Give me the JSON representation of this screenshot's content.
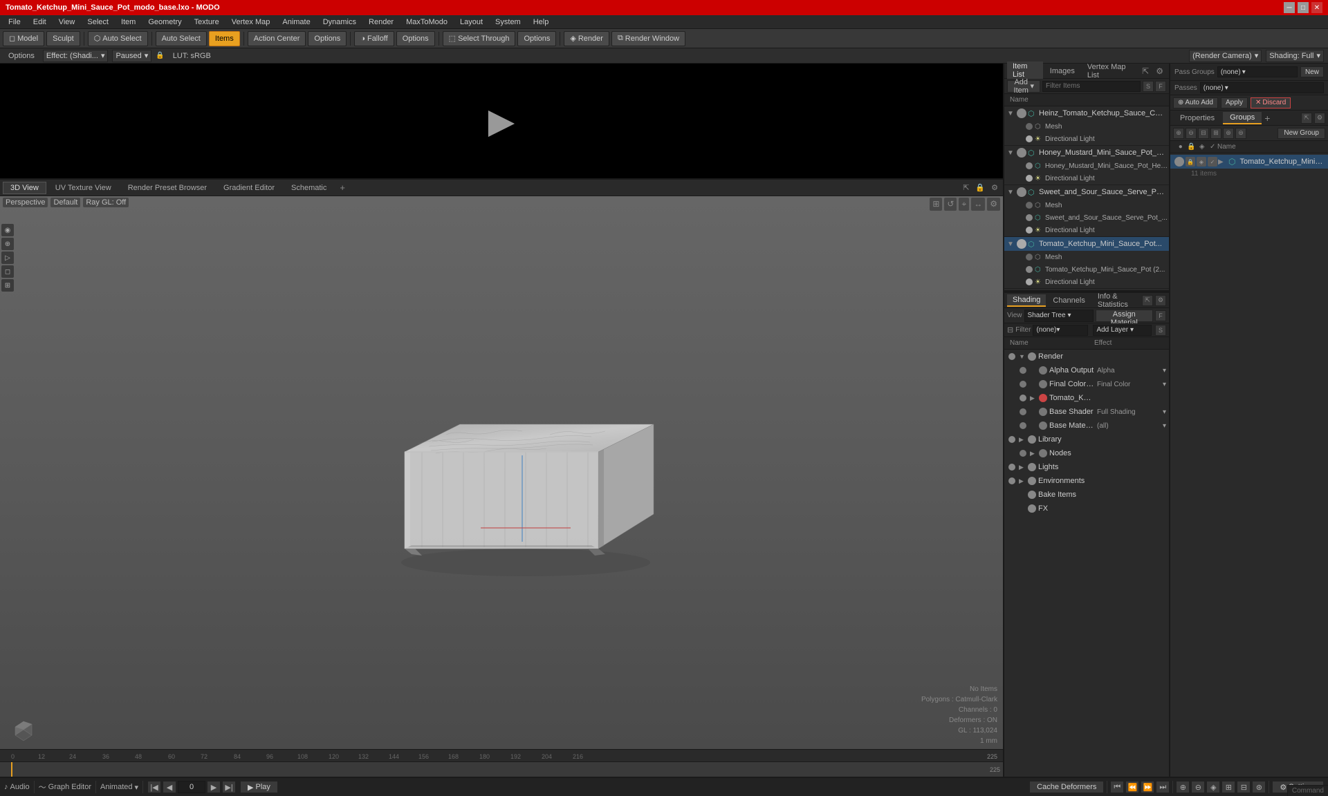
{
  "titlebar": {
    "title": "Tomato_Ketchup_Mini_Sauce_Pot_modo_base.lxo - MODO",
    "buttons": [
      "minimize",
      "maximize",
      "close"
    ]
  },
  "menubar": {
    "items": [
      "File",
      "Edit",
      "View",
      "Select",
      "Item",
      "Geometry",
      "Texture",
      "Vertex Map",
      "Animate",
      "Dynamics",
      "Render",
      "MaxToModo",
      "Layout",
      "System",
      "Help"
    ]
  },
  "toolbar": {
    "modes": [
      "Model",
      "Sculpt"
    ],
    "buttons": [
      "Auto Select",
      "Select",
      "Items"
    ],
    "items_active": true,
    "center_buttons": [
      "Action Center",
      "Options",
      "Falloff",
      "Options"
    ],
    "right_buttons": [
      "Select Through",
      "Options",
      "Render",
      "Render Window"
    ]
  },
  "options_bar": {
    "options_label": "Options",
    "effect_label": "Effect: (Shadi...",
    "status": "Paused",
    "lut": "LUT: sRGB",
    "render_camera": "(Render Camera)",
    "shading_full": "Shading: Full"
  },
  "viewport_tabs": {
    "tabs": [
      "3D View",
      "UV Texture View",
      "Render Preset Browser",
      "Gradient Editor",
      "Schematic"
    ],
    "active": "3D View",
    "add": "+"
  },
  "viewport": {
    "perspective": "Perspective",
    "shader": "Default",
    "raygl": "Ray GL: Off",
    "stats": {
      "items": "No Items",
      "polygons": "Polygons : Catmull-Clark",
      "channels": "Channels : 0",
      "deformers": "Deformers : ON",
      "gl": "GL : 113,024",
      "scale": "1 mm"
    }
  },
  "item_list": {
    "tabs": [
      "Item List",
      "Images",
      "Vertex Map List"
    ],
    "active_tab": "Item List",
    "add_item_label": "Add Item",
    "filter_placeholder": "Filter Items",
    "column": "Name",
    "items": [
      {
        "id": "heinz_group",
        "label": "Heinz_Tomato_Ketchup_Sauce_Cup_...",
        "expanded": true,
        "type": "mesh_group",
        "children": [
          {
            "label": "Mesh",
            "type": "mesh"
          },
          {
            "label": "Directional Light",
            "type": "light"
          }
        ]
      },
      {
        "id": "honey_mustard_group",
        "label": "Honey_Mustard_Mini_Sauce_Pot_Heinz ...",
        "expanded": true,
        "type": "mesh_group",
        "children": [
          {
            "label": "Honey_Mustard_Mini_Sauce_Pot_Hei ...",
            "type": "mesh_group"
          },
          {
            "label": "Directional Light",
            "type": "light"
          }
        ]
      },
      {
        "id": "sweet_sour_group",
        "label": "Sweet_and_Sour_Sauce_Serve_Pot_Hei...",
        "expanded": true,
        "type": "mesh_group",
        "children": [
          {
            "label": "Mesh",
            "type": "mesh"
          },
          {
            "label": "Sweet_and_Sour_Sauce_Serve_Pot_...",
            "type": "mesh_group"
          },
          {
            "label": "Directional Light",
            "type": "light"
          }
        ]
      },
      {
        "id": "tomato_group",
        "label": "Tomato_Ketchup_Mini_Sauce_Pot...",
        "expanded": true,
        "type": "mesh_group",
        "selected": true,
        "children": [
          {
            "label": "Mesh",
            "type": "mesh"
          },
          {
            "label": "Tomato_Ketchup_Mini_Sauce_Pot (2...",
            "type": "mesh_group"
          },
          {
            "label": "Directional Light",
            "type": "light"
          }
        ]
      }
    ]
  },
  "pass_groups": {
    "label": "Pass Groups",
    "passes_label": "Passes",
    "dropdown_value": "(none)",
    "passes_value": "(none)",
    "new_button": "New"
  },
  "properties_panel": {
    "tabs": [
      "Properties",
      "Groups"
    ],
    "active_tab": "Groups",
    "new_group_label": "New Group",
    "name_column": "Name",
    "groups": [
      {
        "id": "tomato_group",
        "label": "Tomato_Ketchup_Mini_Sauc...",
        "count": "11 items",
        "selected": true
      }
    ]
  },
  "shading_panel": {
    "tabs": [
      "Shading",
      "Channels",
      "Info & Statistics"
    ],
    "active_tab": "Shading",
    "view_dropdown": "Shader Tree",
    "assign_material": "Assign Material",
    "filter_dropdown": "(none)",
    "add_layer": "Add Layer",
    "columns": {
      "name": "Name",
      "effect": "Effect"
    },
    "tree": [
      {
        "id": "render",
        "label": "Render",
        "type": "folder",
        "expanded": true,
        "dot_color": "#999",
        "effect": "",
        "children": [
          {
            "id": "alpha_output",
            "label": "Alpha Output",
            "effect": "Alpha",
            "dot_color": "#888",
            "indent": 1
          },
          {
            "id": "final_color_output",
            "label": "Final Color Output",
            "effect": "Final Color",
            "dot_color": "#888",
            "indent": 1
          },
          {
            "id": "tomato_material",
            "label": "Tomato_Ketchup_Mini_Sau...",
            "effect": "",
            "dot_color": "#cc4444",
            "indent": 1
          },
          {
            "id": "base_shader",
            "label": "Base Shader",
            "effect": "Full Shading",
            "dot_color": "#888",
            "indent": 1
          },
          {
            "id": "base_material",
            "label": "Base Material",
            "effect": "(all)",
            "dot_color": "#888",
            "indent": 1
          }
        ]
      },
      {
        "id": "library",
        "label": "Library",
        "type": "folder",
        "expanded": true,
        "dot_color": "#999",
        "effect": ""
      },
      {
        "id": "nodes",
        "label": "Nodes",
        "type": "folder",
        "expanded": false,
        "indent": 1,
        "dot_color": "#999",
        "effect": ""
      },
      {
        "id": "lights",
        "label": "Lights",
        "type": "folder",
        "expanded": true,
        "dot_color": "#999",
        "effect": ""
      },
      {
        "id": "environments",
        "label": "Environments",
        "type": "folder",
        "expanded": true,
        "dot_color": "#999",
        "effect": ""
      },
      {
        "id": "bake_items",
        "label": "Bake Items",
        "type": "item",
        "dot_color": "#999",
        "effect": ""
      },
      {
        "id": "fx",
        "label": "FX",
        "type": "item",
        "dot_color": "#999",
        "effect": ""
      }
    ]
  },
  "bottom_bar": {
    "audio_label": "Audio",
    "graph_editor_label": "Graph Editor",
    "animated_label": "Animated",
    "frame_value": "0",
    "play_label": "Play",
    "cache_deformers": "Cache Deformers",
    "settings_label": "Settings"
  },
  "icons": {
    "play": "▶",
    "expand": "▶",
    "collapse": "▼",
    "chevron_down": "▾",
    "plus": "+",
    "folder": "📁",
    "eye": "●",
    "gear": "⚙",
    "close": "✕",
    "minimize": "─",
    "maximize": "□"
  }
}
